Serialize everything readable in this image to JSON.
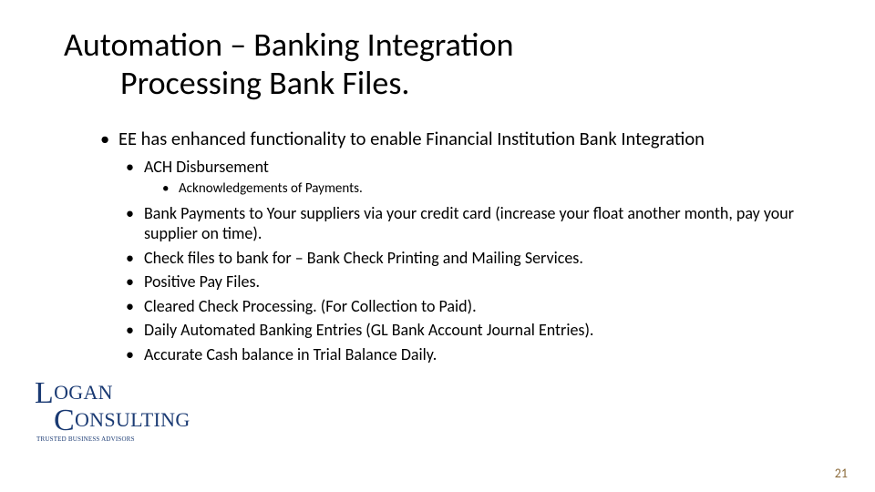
{
  "title_line1": "Automation – Banking Integration",
  "title_line2": "Processing Bank Files.",
  "bullets": {
    "lvl1_0": "EE has enhanced functionality to enable Financial Institution Bank Integration",
    "lvl2_0": "ACH Disbursement",
    "lvl3_0": "Acknowledgements of Payments.",
    "lvl2_1": "Bank Payments to Your suppliers via your credit card (increase your float another month, pay your supplier on time).",
    "lvl2_2": "Check files to bank for – Bank Check Printing and Mailing Services.",
    "lvl2_3": "Positive Pay Files.",
    "lvl2_4": "Cleared Check Processing.  (For Collection to Paid).",
    "lvl2_5": "Daily Automated Banking Entries (GL Bank Account Journal Entries).",
    "lvl2_6": "Accurate Cash balance in Trial Balance Daily."
  },
  "logo": {
    "word1_rest": "OGAN",
    "word2_rest": "ONSULTING",
    "tagline": "TRUSTED BUSINESS ADVISORS"
  },
  "page_number": "21"
}
